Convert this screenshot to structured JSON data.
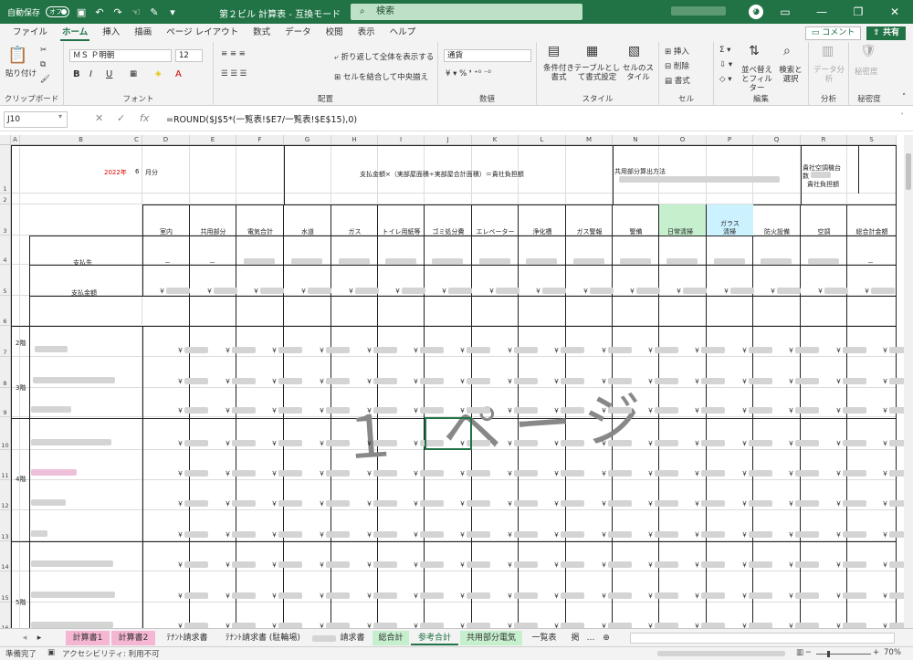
{
  "titlebar": {
    "autosave_label": "自動保存",
    "autosave_state": "オフ",
    "doc_title": "第２ビル 計算表 - 互換モード",
    "search_placeholder": "検索"
  },
  "menu": [
    "ファイル",
    "ホーム",
    "挿入",
    "描画",
    "ページ レイアウト",
    "数式",
    "データ",
    "校閲",
    "表示",
    "ヘルプ"
  ],
  "menu_right": {
    "comment": "コメント",
    "share": "共有"
  },
  "ribbon": {
    "clipboard": {
      "paste": "貼り付け",
      "label": "クリップボード"
    },
    "font": {
      "name": "ＭＳ Ｐ明朝",
      "size": "12",
      "bold": "B",
      "italic": "I",
      "underline": "U",
      "grow": "A",
      "shrink": "A",
      "label": "フォント"
    },
    "align": {
      "wrap": "折り返して全体を表示する",
      "merge": "セルを結合して中央揃え",
      "label": "配置"
    },
    "number": {
      "format": "通貨",
      "label": "数値"
    },
    "style": {
      "cond": "条件付き書式",
      "table": "テーブルとして書式設定",
      "cell": "セルのスタイル",
      "label": "スタイル"
    },
    "cells": {
      "insert": "挿入",
      "delete": "削除",
      "format": "書式",
      "label": "セル"
    },
    "edit": {
      "sort": "並べ替えとフィルター",
      "find": "検索と選択",
      "label": "編集"
    },
    "analysis": {
      "data": "データ分析",
      "label": "分析"
    },
    "sensitivity": {
      "btn": "秘密度",
      "label": "秘密度"
    }
  },
  "formula": {
    "namebox": "J10",
    "text": "=ROUND($J$5*(一覧表!$E7/一覧表!$E$15),0)"
  },
  "columns": [
    "A",
    "B",
    "C",
    "D",
    "E",
    "F",
    "G",
    "H",
    "I",
    "J",
    "K",
    "L",
    "M",
    "N",
    "O",
    "P",
    "Q",
    "R",
    "S"
  ],
  "rows": [
    "1",
    "2",
    "3",
    "4",
    "5",
    "6",
    "7",
    "8",
    "9",
    "10",
    "11",
    "12",
    "13",
    "14",
    "15",
    "16"
  ],
  "sheet": {
    "year": "2022年",
    "month_num": "6",
    "month_label": "月分",
    "formula_note": "支払金額×（実部屋面積÷実部屋合計面積）＝貴社負担額",
    "common_method": "共用部分算出方法",
    "tenant_note_1": "貴社空調機台",
    "tenant_note_2": "数",
    "tenant_note_3": "貴社負担額",
    "headers": [
      "室内",
      "共用部分",
      "電気合計",
      "水道",
      "ガス",
      "トイレ用紙等",
      "ゴミ処分費",
      "エレベーター",
      "浄化槽",
      "ガス警報",
      "警備",
      "日常清掃",
      "ガラス清掃",
      "防火設備",
      "空調",
      "総合計金額"
    ],
    "glass_l1": "ガラス",
    "glass_l2": "清掃",
    "payee": "支払先",
    "amount": "支払金額",
    "dash": "－",
    "yen": "￥",
    "floor2": "2階",
    "floor3": "3階",
    "floor4": "4階",
    "floor5": "5階"
  },
  "watermark": "１ ページ",
  "tabs": [
    "計算書1",
    "計算書2",
    "ﾃﾅﾝﾄ請求書",
    "ﾃﾅﾝﾄ請求書 (駐輪場)",
    "請求書",
    "総合計",
    "参考合計",
    "共用部分電気",
    "一覧表",
    "掲"
  ],
  "tab_colors": {
    "pink": "#f4b6d2",
    "green": "#c6efce"
  },
  "status": {
    "ready": "準備完了",
    "access": "アクセシビリティ: 利用不可",
    "zoom": "70%"
  }
}
